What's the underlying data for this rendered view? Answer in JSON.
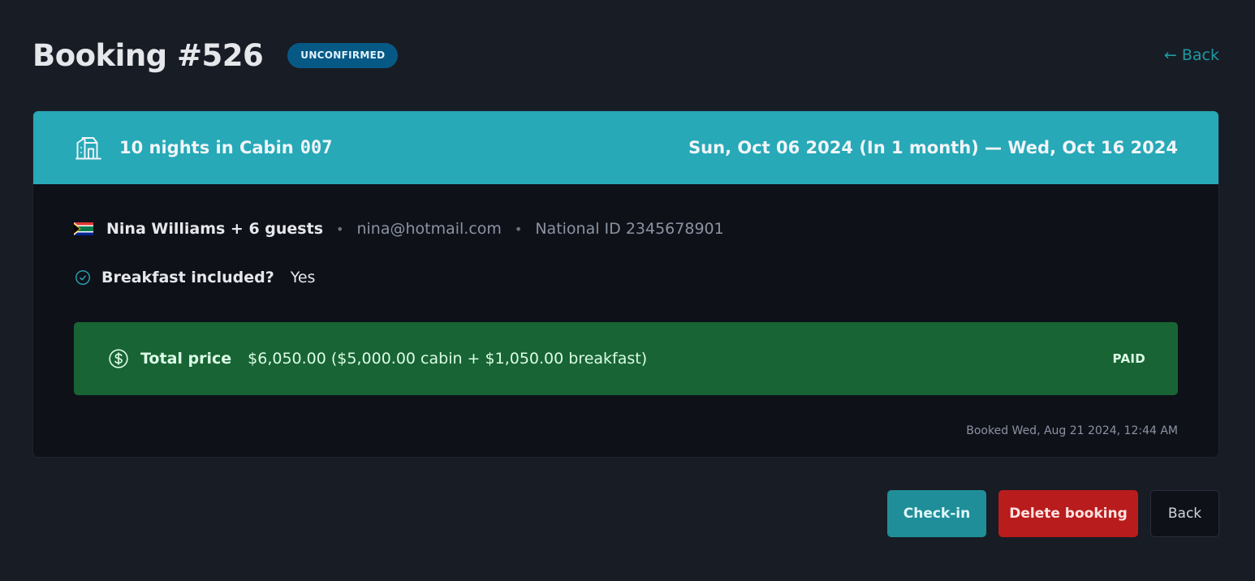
{
  "header": {
    "title": "Booking #526",
    "status": "UNCONFIRMED",
    "back_link": "← Back"
  },
  "stay": {
    "summary": "10 nights in Cabin",
    "cabin_number": "007",
    "dates": "Sun, Oct 06 2024 (In 1 month) — Wed, Oct 16 2024"
  },
  "guest": {
    "name": "Nina Williams + 6 guests",
    "email": "nina@hotmail.com",
    "national_id": "National ID 2345678901",
    "separator": "•",
    "flag": "south-africa-flag"
  },
  "breakfast": {
    "label": "Breakfast included?",
    "value": "Yes",
    "icon": "check-circle-icon"
  },
  "price": {
    "label": "Total price",
    "value": "$6,050.00 ($5,000.00 cabin + $1,050.00 breakfast)",
    "status": "PAID",
    "icon": "dollar-circle-icon"
  },
  "booked_at": "Booked Wed, Aug 21 2024, 12:44 AM",
  "actions": {
    "checkin": "Check-in",
    "delete": "Delete booking",
    "back": "Back"
  },
  "colors": {
    "background": "#181c24",
    "card": "#0f1119",
    "header_band": "#27a9b7",
    "badge": "#075985",
    "price_box": "#186434",
    "accent": "#1f9aa3",
    "delete": "#b91c1c"
  }
}
